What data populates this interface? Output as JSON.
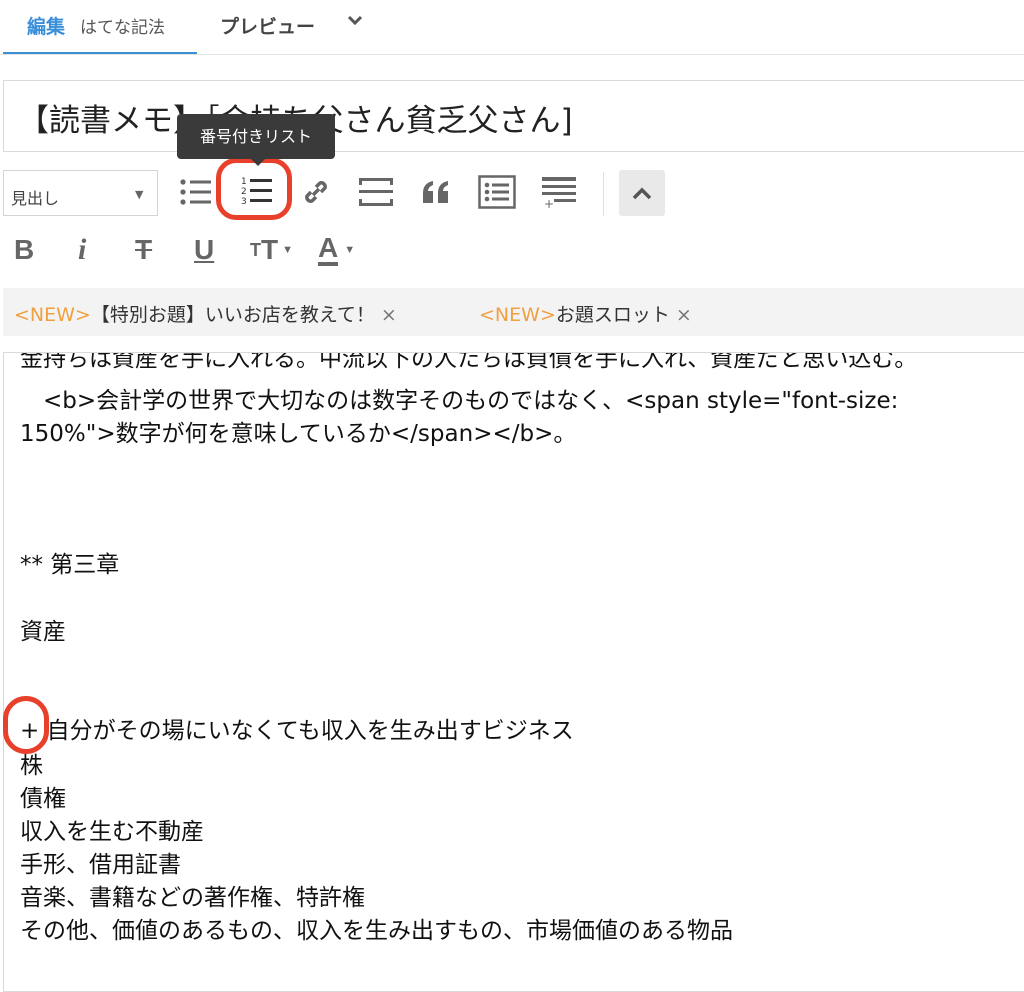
{
  "tabs": {
    "edit_label": "編集",
    "edit_mode": "はてな記法",
    "preview_label": "プレビュー"
  },
  "title": {
    "value": "【読書メモ】［金持ち父さん貧乏父さん]"
  },
  "tooltip": {
    "text": "番号付きリスト"
  },
  "toolbar": {
    "heading_select": {
      "selected": "見出し"
    },
    "icons": [
      "bulleted-list-icon",
      "numbered-list-icon",
      "link-icon",
      "horizontal-rule-icon",
      "quote-icon",
      "definition-list-icon",
      "table-icon",
      "collapse-icon"
    ],
    "format": {
      "bold": "B",
      "italic": "i",
      "strike": "T",
      "underline": "U",
      "size": "T",
      "color": "A"
    }
  },
  "tags": [
    {
      "new": "<NEW>",
      "label": "【特別お題】いいお店を教えて！",
      "close": "×"
    },
    {
      "new": "<NEW>",
      "label": "お題スロット",
      "close": "×"
    }
  ],
  "editor": {
    "lines": [
      "金持ちは資産を手に入れる。中流以下の人たちは負債を手に入れ、資産だと思い込む。",
      "　<b>会計学の世界で大切なのは数字そのものではなく、<span style=\"font-size:",
      "150%\">数字が何を意味しているか</span></b>。",
      "** 第三章",
      "資産",
      "+ 自分がその場にいなくても収入を生み出すビジネス",
      "株",
      "債権",
      "収入を生む不動産",
      "手形、借用証書",
      "音楽、書籍などの著作権、特許権",
      "その他、価値のあるもの、収入を生み出すもの、市場価値のある物品"
    ]
  },
  "colors": {
    "accent": "#3a8fd8",
    "highlight": "#e8402b",
    "new_tag": "#f0a040"
  }
}
